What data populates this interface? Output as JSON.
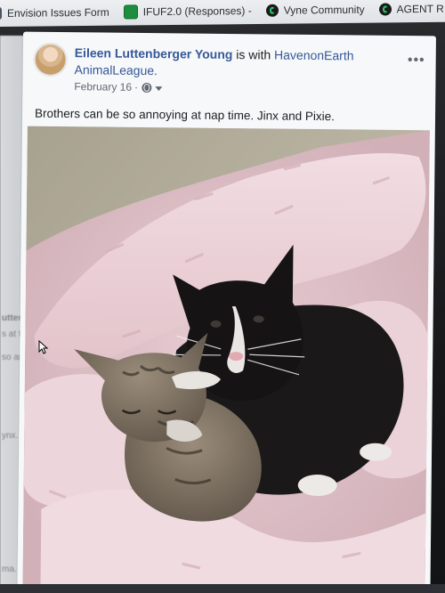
{
  "bookmarks": [
    {
      "label": "Envision Issues Form",
      "icon": "doc-icon"
    },
    {
      "label": "IFUF2.0 (Responses) -",
      "icon": "sheet-icon"
    },
    {
      "label": "Vyne Community",
      "icon": "vyne-icon"
    },
    {
      "label": "AGENT R",
      "icon": "vyne-icon"
    }
  ],
  "background_page": {
    "snippets": [
      "uttenbe",
      "s at the",
      "so annoy",
      "ynx. Jack",
      "ma. Saturd"
    ]
  },
  "post": {
    "author": "Eileen Luttenberger Young",
    "connector": "is with",
    "with_name": "HavenonEarth AnimalLeague.",
    "date": "February 16",
    "separator": "·",
    "privacy_icon": "globe-icon",
    "more_icon_glyph": "•••",
    "caption": "Brothers can be so annoying at nap time. Jinx and Pixie."
  },
  "colors": {
    "link_blue": "#365899",
    "text": "#1c1e21",
    "meta_gray": "#606770",
    "card_bg": "#f7f8fa"
  }
}
